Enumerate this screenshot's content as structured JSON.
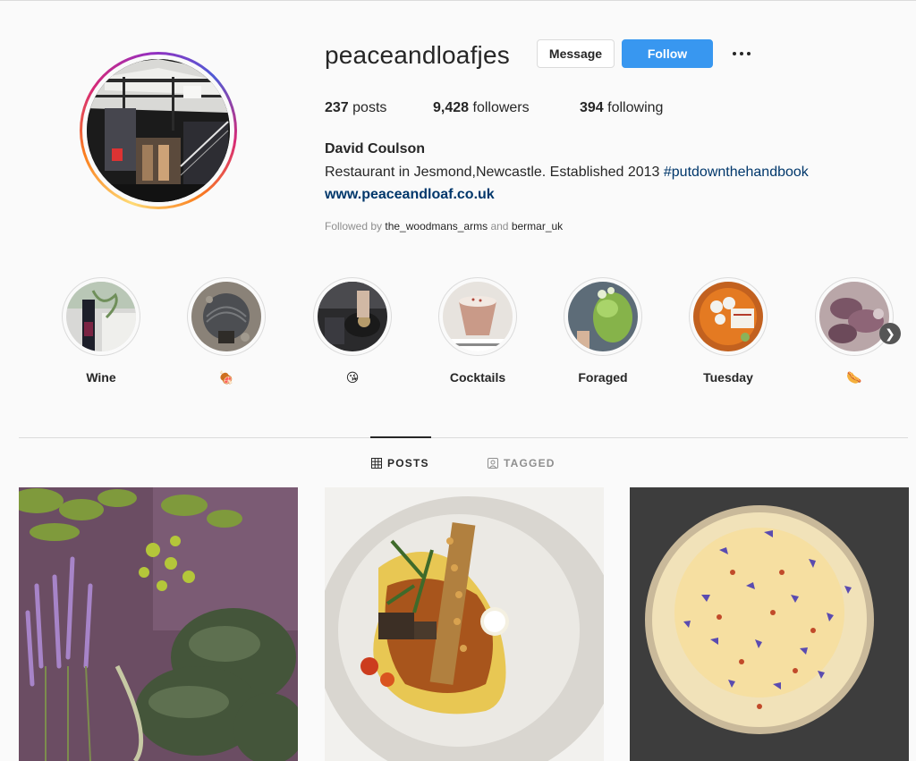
{
  "profile": {
    "username": "peaceandloafjes",
    "message_label": "Message",
    "follow_label": "Follow",
    "stats": {
      "posts_count": "237",
      "posts_label": "posts",
      "followers_count": "9,428",
      "followers_label": "followers",
      "following_count": "394",
      "following_label": "following"
    },
    "full_name": "David Coulson",
    "bio_text": "Restaurant in Jesmond,Newcastle. Established 2013 ",
    "bio_hashtag": "#putdownthehandbook",
    "website": "www.peaceandloaf.co.uk",
    "followed_by_prefix": "Followed by ",
    "followed_by_user1": "the_woodmans_arms",
    "followed_by_and": " and ",
    "followed_by_user2": "bermar_uk"
  },
  "highlights": [
    {
      "label": "Wine"
    },
    {
      "label": "🍖"
    },
    {
      "label": "😘"
    },
    {
      "label": "Cocktails"
    },
    {
      "label": "Foraged"
    },
    {
      "label": "Tuesday"
    },
    {
      "label": "🌭"
    }
  ],
  "tabs": {
    "posts": "POSTS",
    "tagged": "TAGGED"
  },
  "colors": {
    "follow_button": "#3897f0",
    "link": "#00376b",
    "background": "#fafafa"
  }
}
